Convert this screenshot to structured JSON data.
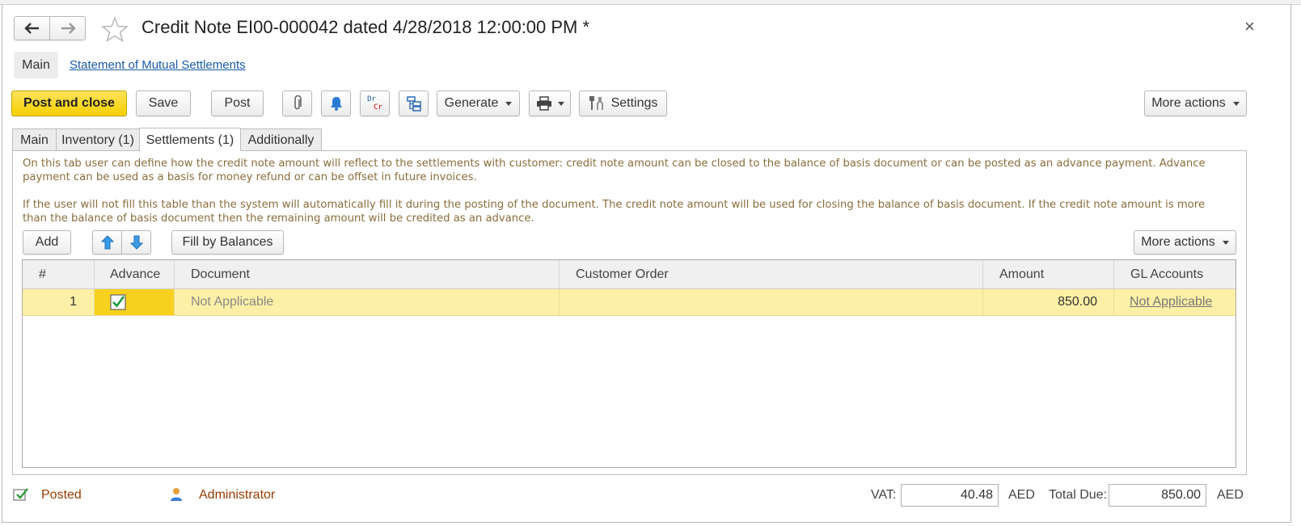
{
  "window": {
    "title": "Credit Note EI00-000042 dated 4/28/2018 12:00:00 PM *",
    "close_symbol": "×"
  },
  "nav_links": {
    "main": "Main",
    "statement": "Statement of Mutual Settlements"
  },
  "toolbar": {
    "post_and_close": "Post and close",
    "save": "Save",
    "post": "Post",
    "drcr_top": "Dr",
    "drcr_bottom": "Cr",
    "generate": "Generate",
    "settings": "Settings",
    "more_actions": "More actions"
  },
  "tabs": [
    {
      "label": "Main"
    },
    {
      "label": "Inventory (1)"
    },
    {
      "label": "Settlements (1)"
    },
    {
      "label": "Additionally"
    }
  ],
  "info": {
    "paragraph1": "On this tab user can define how the credit note amount will reflect to the settlements with customer: credit note amount can be closed to the balance of basis document or can be posted as an advance payment. Advance payment can be used as a basis for money refund or can be offset in future invoices.",
    "paragraph2": "If the user will not fill this table than the system will automatically fill it during the posting of the document. The credit note amount will be used for closing the balance of basis document. If the credit note amount is more than the balance of basis document then the remaining amount will be credited as an advance."
  },
  "table_toolbar": {
    "add": "Add",
    "fill_by_balances": "Fill by Balances",
    "more_actions": "More actions"
  },
  "table": {
    "columns": [
      "#",
      "Advance",
      "Document",
      "Customer Order",
      "Amount",
      "GL Accounts"
    ],
    "rows": [
      {
        "num": "1",
        "advance": true,
        "document": "Not Applicable",
        "customer_order": "",
        "amount": "850.00",
        "gl_accounts": "Not Applicable"
      }
    ]
  },
  "footer": {
    "status": "Posted",
    "user": "Administrator",
    "vat_label": "VAT:",
    "vat_value": "40.48",
    "vat_currency": "AED",
    "total_label": "Total Due:",
    "total_value": "850.00",
    "total_currency": "AED"
  },
  "colors": {
    "primary_button": "#f5cf00",
    "selected_row": "#fdf0a6",
    "info_text": "#8a6d3b",
    "link": "#1a5aa8",
    "status_text": "#9a3a00"
  }
}
